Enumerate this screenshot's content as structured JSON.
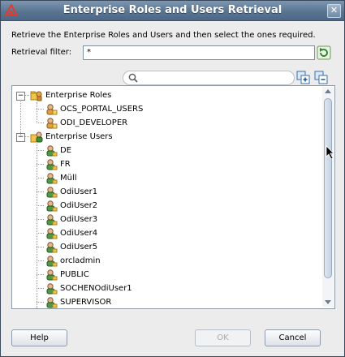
{
  "window": {
    "title": "Enterprise Roles and Users Retrieval",
    "close_glyph": "✕"
  },
  "instructions": "Retrieve the Enterprise Roles and Users and then select the ones required.",
  "filter": {
    "label": "Retrieval filter:",
    "value": "*"
  },
  "tree": {
    "roles_group": {
      "label": "Enterprise Roles",
      "expanded": true,
      "icon": "roles-folder-icon",
      "items": [
        "OCS_PORTAL_USERS",
        "ODI_DEVELOPER"
      ]
    },
    "users_group": {
      "label": "Enterprise Users",
      "expanded": true,
      "icon": "users-folder-icon",
      "items": [
        "DE",
        "FR",
        "Müll",
        "OdiUser1",
        "OdiUser2",
        "OdiUser3",
        "OdiUser4",
        "OdiUser5",
        "orcladmin",
        "PUBLIC",
        "SOCHENOdiUser1",
        "SUPERVISOR"
      ]
    }
  },
  "buttons": {
    "help": "Help",
    "ok": "OK",
    "cancel": "Cancel"
  },
  "colors": {
    "title_bar": "#5a7592",
    "panel_bg": "#ececec",
    "tree_bg": "#ffffff"
  }
}
